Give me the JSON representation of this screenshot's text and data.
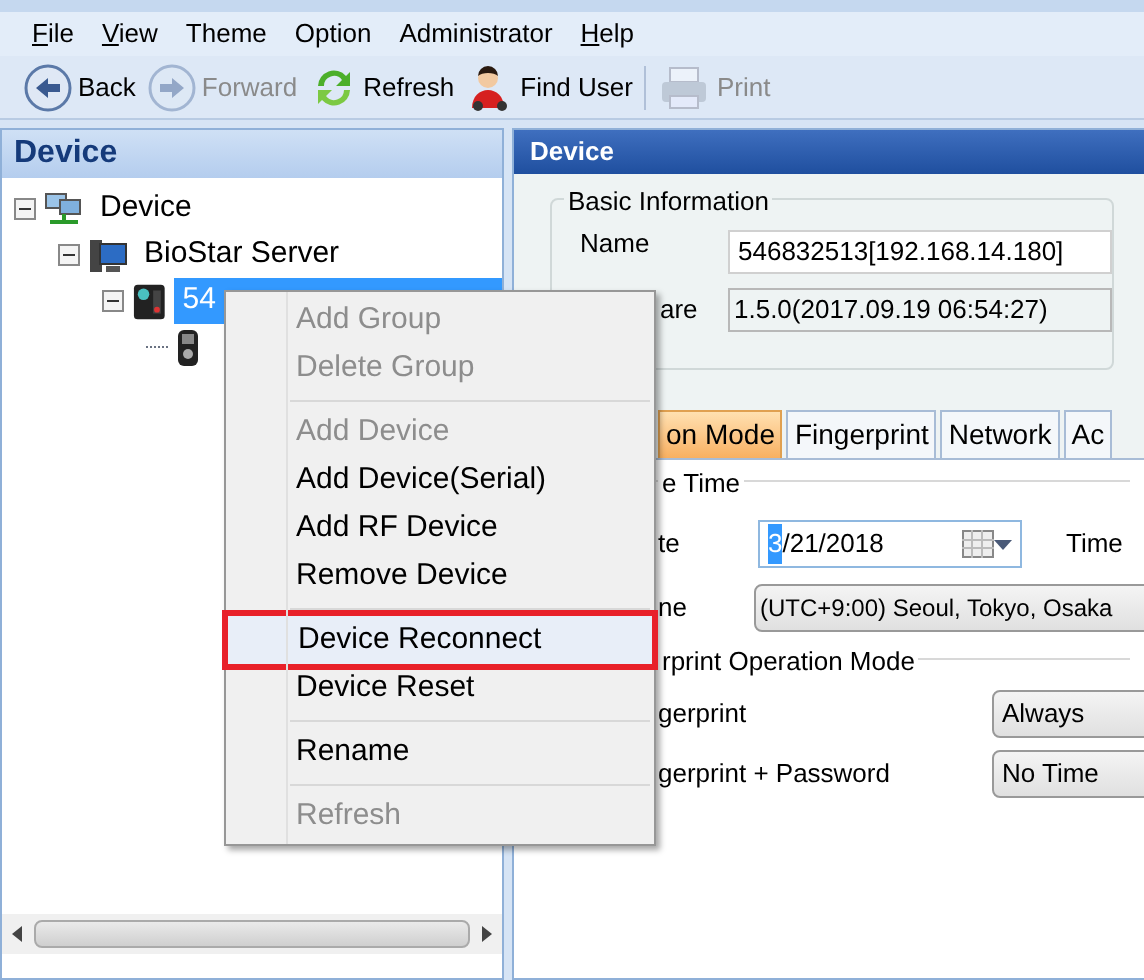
{
  "menubar": [
    {
      "label": "File",
      "mnemonic": true
    },
    {
      "label": "View",
      "mnemonic": true
    },
    {
      "label": "Theme",
      "mnemonic": false
    },
    {
      "label": "Option",
      "mnemonic": false
    },
    {
      "label": "Administrator",
      "mnemonic": false
    },
    {
      "label": "Help",
      "mnemonic": true
    }
  ],
  "toolbar": [
    {
      "kind": "back",
      "label": "Back",
      "disabled": false
    },
    {
      "kind": "forward",
      "label": "Forward",
      "disabled": true
    },
    {
      "kind": "refresh",
      "label": "Refresh",
      "disabled": false
    },
    {
      "kind": "user",
      "label": "Find User",
      "disabled": false
    },
    {
      "kind": "print",
      "label": "Print",
      "disabled": true
    }
  ],
  "left_panel": {
    "title": "Device",
    "tree": [
      {
        "kind": "network",
        "label": "Device",
        "expanded": true,
        "selected": false,
        "children": [
          {
            "kind": "server",
            "label": "BioStar Server",
            "expanded": true,
            "selected": false,
            "children": [
              {
                "kind": "terminal",
                "label": "54",
                "expanded": true,
                "selected": true,
                "children": [
                  {
                    "kind": "reader"
                  }
                ]
              }
            ]
          }
        ]
      }
    ]
  },
  "right_panel": {
    "title": "Device",
    "basic_information": {
      "title": "Basic Information",
      "name_label": "Name",
      "name_value": "546832513[192.168.14.180]",
      "firmware_label": "are",
      "firmware_value": "1.5.0(2017.09.19 06:54:27)"
    },
    "tabs": [
      {
        "label": "on Mode",
        "selected": true
      },
      {
        "label": "Fingerprint",
        "selected": false
      },
      {
        "label": "Network",
        "selected": false
      },
      {
        "label": "Ac",
        "selected": false
      }
    ],
    "time_group": {
      "title": "e Time",
      "date_label": "te",
      "date_value_highlight": "3",
      "date_value": "/21/2018",
      "time_label": "Time",
      "zone_label": "ne",
      "zone_value": "(UTC+9:00) Seoul, Tokyo, Osaka"
    },
    "fingerprint_group": {
      "title": "rprint Operation Mode",
      "rows": [
        {
          "label": "gerprint",
          "value": "Always"
        },
        {
          "label": "gerprint + Password",
          "value": "No Time"
        }
      ]
    }
  },
  "context_menu": [
    {
      "kind": "item",
      "label": "Add Group",
      "disabled": true,
      "selected": false
    },
    {
      "kind": "item",
      "label": "Delete Group",
      "disabled": true,
      "selected": false
    },
    {
      "kind": "separator"
    },
    {
      "kind": "item",
      "label": "Add Device",
      "disabled": true,
      "selected": false
    },
    {
      "kind": "item",
      "label": "Add Device(Serial)",
      "disabled": false,
      "selected": false
    },
    {
      "kind": "item",
      "label": "Add RF Device",
      "disabled": false,
      "selected": false
    },
    {
      "kind": "item",
      "label": "Remove Device",
      "disabled": false,
      "selected": false
    },
    {
      "kind": "separator"
    },
    {
      "kind": "item",
      "label": "Device Reconnect",
      "disabled": false,
      "selected": true
    },
    {
      "kind": "item",
      "label": "Device Reset",
      "disabled": false,
      "selected": false
    },
    {
      "kind": "separator"
    },
    {
      "kind": "item",
      "label": "Rename",
      "disabled": false,
      "selected": false
    },
    {
      "kind": "separator"
    },
    {
      "kind": "item",
      "label": "Refresh",
      "disabled": true,
      "selected": false
    }
  ]
}
